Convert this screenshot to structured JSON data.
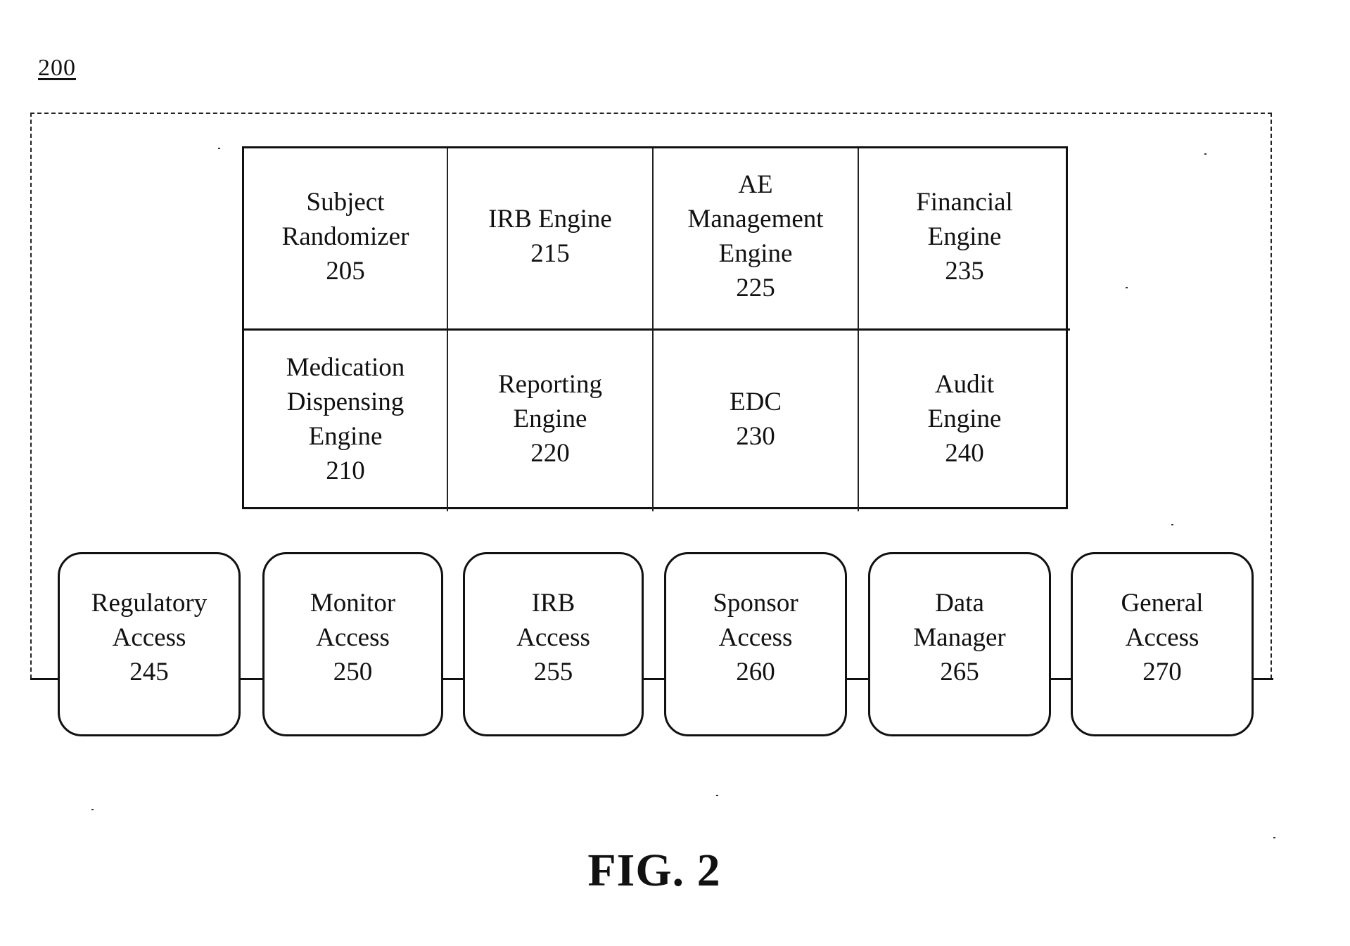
{
  "figure": {
    "reference_number": "200",
    "caption": "FIG. 2"
  },
  "engines": [
    {
      "lines": [
        "Subject",
        "Randomizer",
        "205"
      ]
    },
    {
      "lines": [
        "IRB Engine",
        "215"
      ]
    },
    {
      "lines": [
        "AE",
        "Management",
        "Engine",
        "225"
      ]
    },
    {
      "lines": [
        "Financial",
        "Engine",
        "235"
      ]
    },
    {
      "lines": [
        "Medication",
        "Dispensing",
        "Engine",
        "210"
      ]
    },
    {
      "lines": [
        "Reporting",
        "Engine",
        "220"
      ]
    },
    {
      "lines": [
        "EDC",
        "230"
      ]
    },
    {
      "lines": [
        "Audit",
        "Engine",
        "240"
      ]
    }
  ],
  "access_modules": [
    {
      "lines": [
        "Regulatory",
        "Access",
        "245"
      ]
    },
    {
      "lines": [
        "Monitor",
        "Access",
        "250"
      ]
    },
    {
      "lines": [
        "IRB",
        "Access",
        "255"
      ]
    },
    {
      "lines": [
        "Sponsor",
        "Access",
        "260"
      ]
    },
    {
      "lines": [
        "Data",
        "Manager",
        "265"
      ]
    },
    {
      "lines": [
        "General",
        "Access",
        "270"
      ]
    }
  ]
}
